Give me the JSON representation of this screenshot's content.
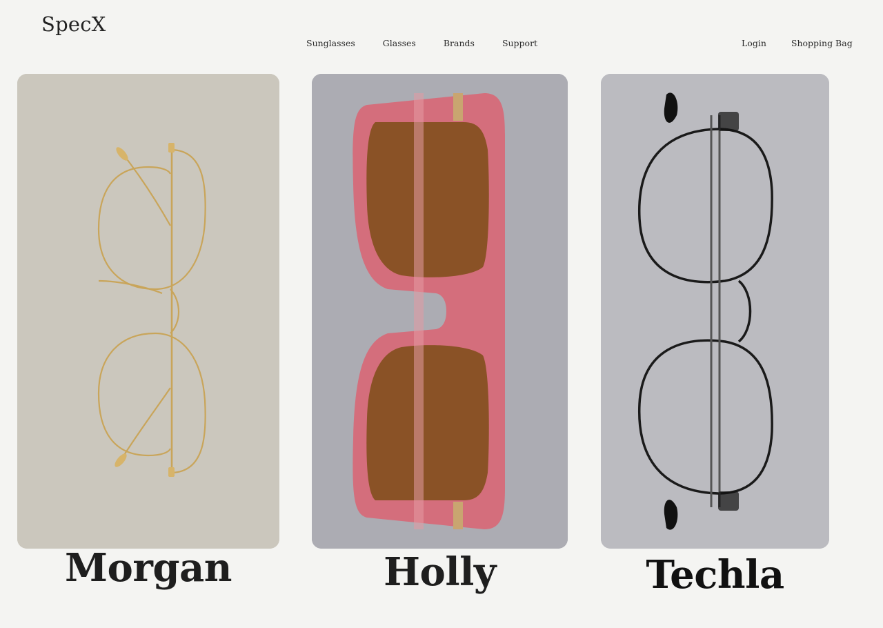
{
  "brand": {
    "logo_text": "SpecX"
  },
  "nav": {
    "items": [
      {
        "label": "Sunglasses"
      },
      {
        "label": "Glasses"
      },
      {
        "label": "Brands"
      },
      {
        "label": "Support"
      }
    ]
  },
  "account": {
    "login_label": "Login",
    "bag_label": "Shopping Bag"
  },
  "products": [
    {
      "name": "Morgan",
      "image": "gold-wire-round-glasses-icon",
      "bg_color": "#cdc9bf"
    },
    {
      "name": "Holly",
      "image": "pink-brown-sunglasses-icon",
      "bg_color": "#adadb4"
    },
    {
      "name": "Techla",
      "image": "black-round-glasses-icon",
      "bg_color": "#bcbcc1"
    }
  ],
  "colors": {
    "page_bg": "#f4f4f2",
    "text": "#1f1f1f"
  }
}
